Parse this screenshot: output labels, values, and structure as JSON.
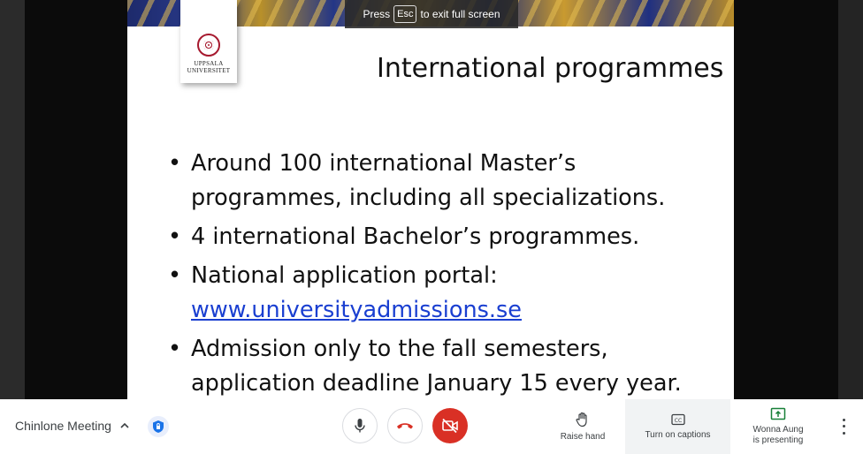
{
  "slide": {
    "logo_line1": "UPPSALA",
    "logo_line2": "UNIVERSITET",
    "title": "International programmes",
    "bullets": [
      {
        "lines": [
          "Around 100 international Master’s",
          "programmes, including all specializations."
        ]
      },
      {
        "lines": [
          "4 international Bachelor’s programmes."
        ]
      },
      {
        "lines": [
          "National application portal:"
        ],
        "link": "www.universityadmissions.se"
      },
      {
        "lines": [
          "Admission only to the fall semesters,",
          "application deadline January 15 every year."
        ]
      }
    ]
  },
  "fullscreen_hint": {
    "prefix": "Press",
    "key": "Esc",
    "suffix": "to exit full screen"
  },
  "toolbar": {
    "meeting_name": "Chinlone Meeting",
    "raise_hand_label": "Raise hand",
    "captions_label": "Turn on captions",
    "presenter_line1": "Wonna Aung",
    "presenter_line2": "is presenting",
    "colors": {
      "hangup": "#d93025",
      "camera_off_bg": "#d93025",
      "present_icon": "#188038",
      "shield": "#1a73e8"
    }
  },
  "icons": [
    "chevron-up-icon",
    "shield-icon",
    "microphone-icon",
    "hang-up-icon",
    "camera-off-icon",
    "raise-hand-icon",
    "closed-captions-icon",
    "present-screen-icon",
    "more-options-icon"
  ]
}
